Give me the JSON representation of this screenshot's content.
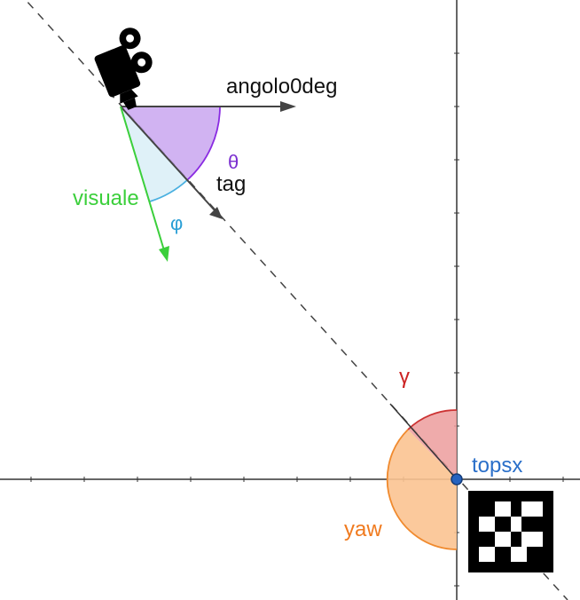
{
  "labels": {
    "angolo0deg": "angolo0deg",
    "theta": "θ",
    "tag": "tag",
    "visuale": "visuale",
    "phi": "φ",
    "gamma": "γ",
    "topsx": "topsx",
    "yaw": "yaw"
  },
  "colors": {
    "axis": "#333333",
    "dashed_line": "#444444",
    "vector": "#444444",
    "theta_fill": "#c9a6f0",
    "theta_stroke": "#8a2be2",
    "theta_label": "#7b2fd0",
    "phi_fill": "#dff1f8",
    "phi_stroke": "#4ab0e0",
    "phi_label": "#2a9fd6",
    "visuale": "#3bcf3b",
    "gamma_fill": "#ec9c9c",
    "gamma_stroke": "#cc3333",
    "gamma_label": "#cc2222",
    "yaw_fill": "#fbc391",
    "yaw_stroke": "#f08a2e",
    "yaw_label": "#f07a1e",
    "topsx_point": "#2563c0",
    "topsx_label": "#2a6fc9",
    "camera": "#000000"
  },
  "icons": {
    "camera": "video-camera-icon",
    "marker": "aruco-marker-icon"
  }
}
